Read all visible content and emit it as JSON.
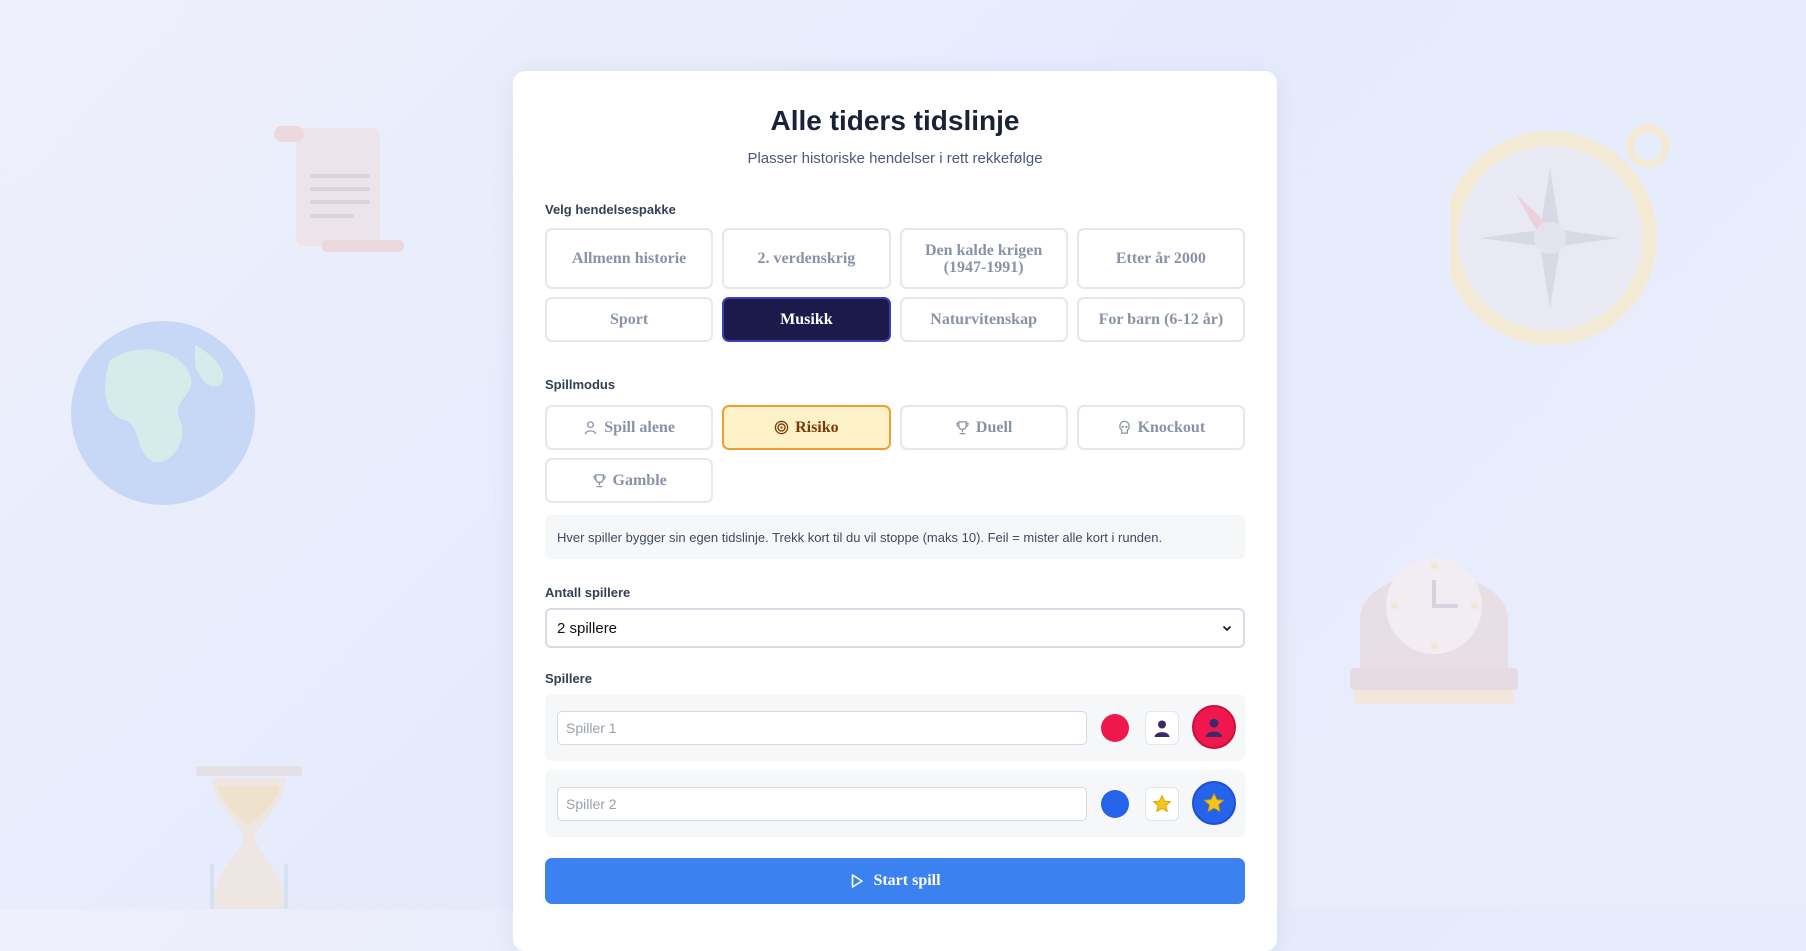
{
  "header": {
    "title": "Alle tiders tidslinje",
    "subtitle": "Plasser historiske hendelser i rett rekkefølge"
  },
  "packs": {
    "label": "Velg hendelsespakke",
    "items": [
      {
        "label": "Allmenn historie"
      },
      {
        "label": "2. verdenskrig"
      },
      {
        "label": "Den kalde krigen (1947-1991)"
      },
      {
        "label": "Etter år 2000"
      },
      {
        "label": "Sport"
      },
      {
        "label": "Musikk",
        "selected": true
      },
      {
        "label": "Naturvitenskap"
      },
      {
        "label": "For barn (6-12 år)"
      }
    ]
  },
  "modes": {
    "label": "Spillmodus",
    "items": [
      {
        "label": "Spill alene",
        "icon": "user-icon"
      },
      {
        "label": "Risiko",
        "icon": "target-icon",
        "selected": true
      },
      {
        "label": "Duell",
        "icon": "trophy-icon"
      },
      {
        "label": "Knockout",
        "icon": "skull-icon"
      },
      {
        "label": "Gamble",
        "icon": "trophy-icon"
      }
    ],
    "description": "Hver spiller bygger sin egen tidslinje. Trekk kort til du vil stoppe (maks 10). Feil = mister alle kort i runden."
  },
  "player_count": {
    "label": "Antall spillere",
    "selected": "2 spillere"
  },
  "players": {
    "label": "Spillere",
    "items": [
      {
        "placeholder": "Spiller 1",
        "color": "#f0174f",
        "icon": "person-icon"
      },
      {
        "placeholder": "Spiller 2",
        "color": "#2563eb",
        "icon": "star-icon"
      }
    ]
  },
  "start_button": {
    "label": "Start spill"
  },
  "colors": {
    "accent": "#3b82f0",
    "selected_pack": "#1c1a4a",
    "selected_mode": "#fdf1c7"
  }
}
